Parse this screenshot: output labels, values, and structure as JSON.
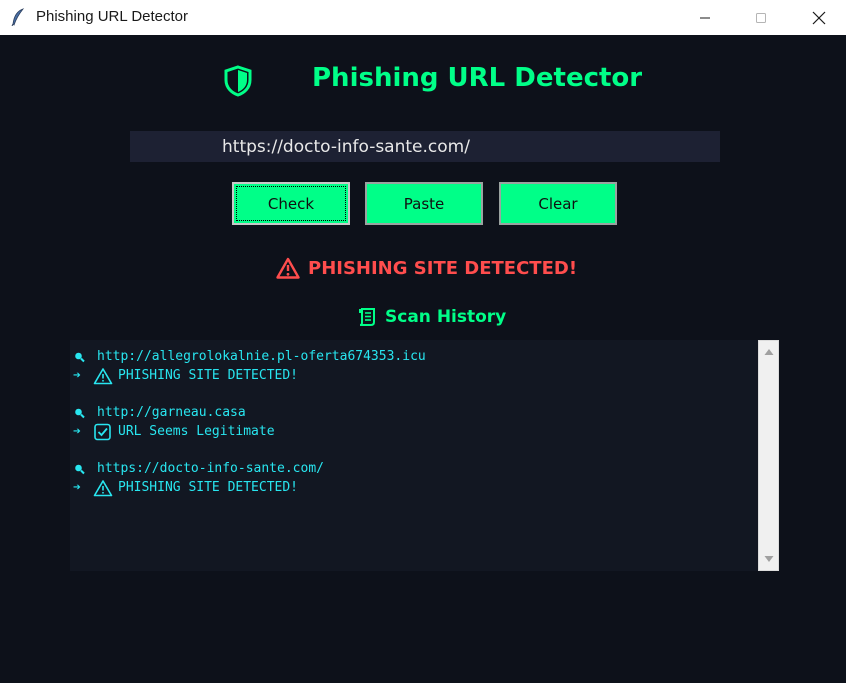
{
  "window": {
    "title": "Phishing URL Detector",
    "app_icon": "feather-icon",
    "controls": [
      "minimize-icon",
      "maximize-icon",
      "close-icon"
    ]
  },
  "header": {
    "icon": "shield-icon",
    "title": "Phishing URL Detector"
  },
  "url_input": {
    "value": "https://docto-info-sante.com/"
  },
  "buttons": {
    "check": "Check",
    "paste": "Paste",
    "clear": "Clear"
  },
  "result": {
    "icon": "warning-icon",
    "text": "PHISHING SITE DETECTED!",
    "color": "#ff4d4d"
  },
  "history": {
    "icon": "scroll-icon",
    "title": "Scan History",
    "entries": [
      {
        "url": "http://allegrolokalnie.pl-oferta674353.icu",
        "arrow": "➔",
        "status_icon": "warning-icon",
        "status": "PHISHING SITE DETECTED!"
      },
      {
        "url": "http://garneau.casa",
        "arrow": "➔",
        "status_icon": "checkbox-icon",
        "status": "URL Seems Legitimate"
      },
      {
        "url": "https://docto-info-sante.com/",
        "arrow": "➔",
        "status_icon": "warning-icon",
        "status": "PHISHING SITE DETECTED!"
      }
    ]
  },
  "colors": {
    "accent": "#00ff88",
    "background": "#0d111a",
    "history_text": "#28e6f0",
    "danger": "#ff4d4d"
  }
}
